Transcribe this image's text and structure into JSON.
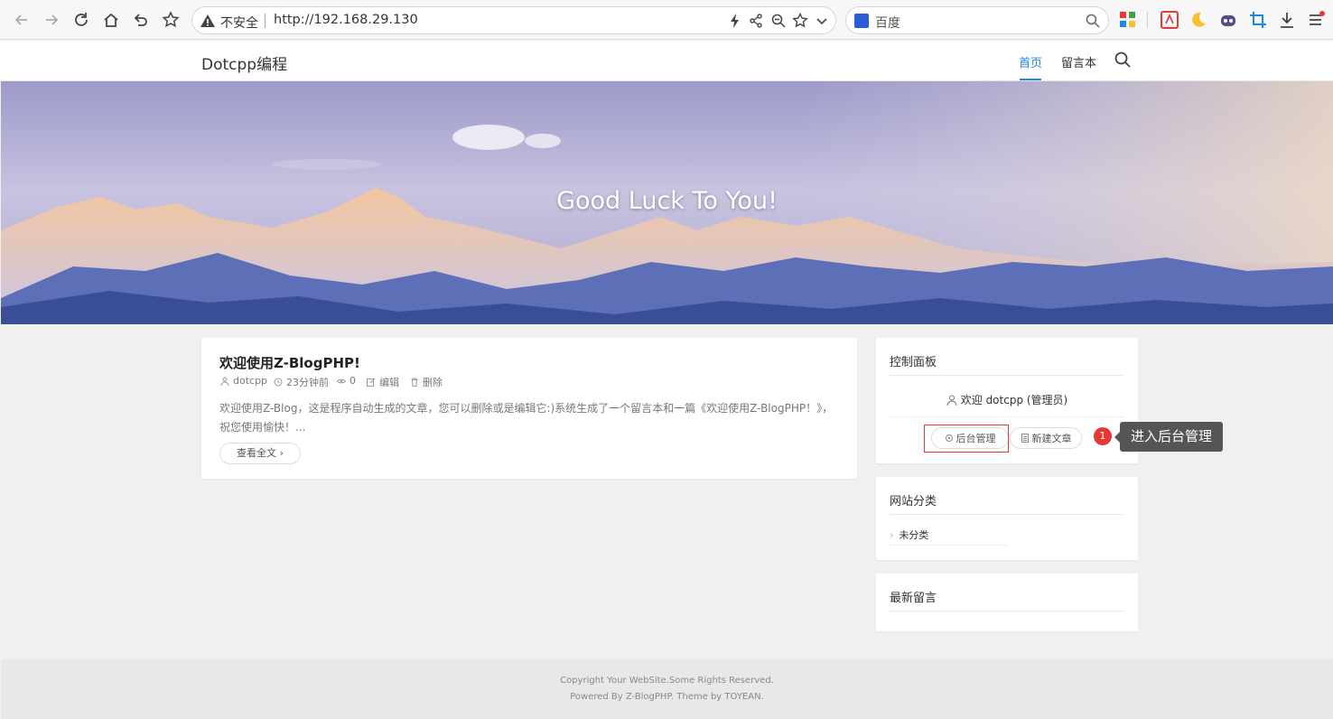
{
  "browser": {
    "security_label": "不安全",
    "url": "http://192.168.29.130",
    "search_engine": "百度",
    "nav_icons": [
      "back-icon",
      "forward-icon",
      "reload-icon",
      "home-icon",
      "undo-icon",
      "star-icon"
    ]
  },
  "site": {
    "brand": "Dotcpp编程",
    "nav": {
      "home": "首页",
      "guestbook": "留言本"
    },
    "hero_title": "Good Luck To You!",
    "accent_color": "#1e88e5"
  },
  "post": {
    "title": "欢迎使用Z-BlogPHP!",
    "author": "dotcpp",
    "time": "23分钟前",
    "views": "0",
    "edit": "编辑",
    "delete": "删除",
    "excerpt": "欢迎使用Z-Blog，这是程序自动生成的文章，您可以删除或是编辑它:)系统生成了一个留言本和一篇《欢迎使用Z-BlogPHP！》，祝您使用愉快！...",
    "read_more": "查看全文"
  },
  "sidebar": {
    "panel_title": "控制面板",
    "welcome": "欢迎 dotcpp (管理员)",
    "admin_button": "后台管理",
    "new_post_button": "新建文章",
    "annotation_number": "1",
    "annotation_text": "进入后台管理",
    "categories_title": "网站分类",
    "category_item": "未分类",
    "latest_comments_title": "最新留言"
  },
  "footer": {
    "copyright": "Copyright Your WebSite.Some Rights Reserved.",
    "powered": "Powered By Z-BlogPHP. Theme by TOYEAN."
  }
}
